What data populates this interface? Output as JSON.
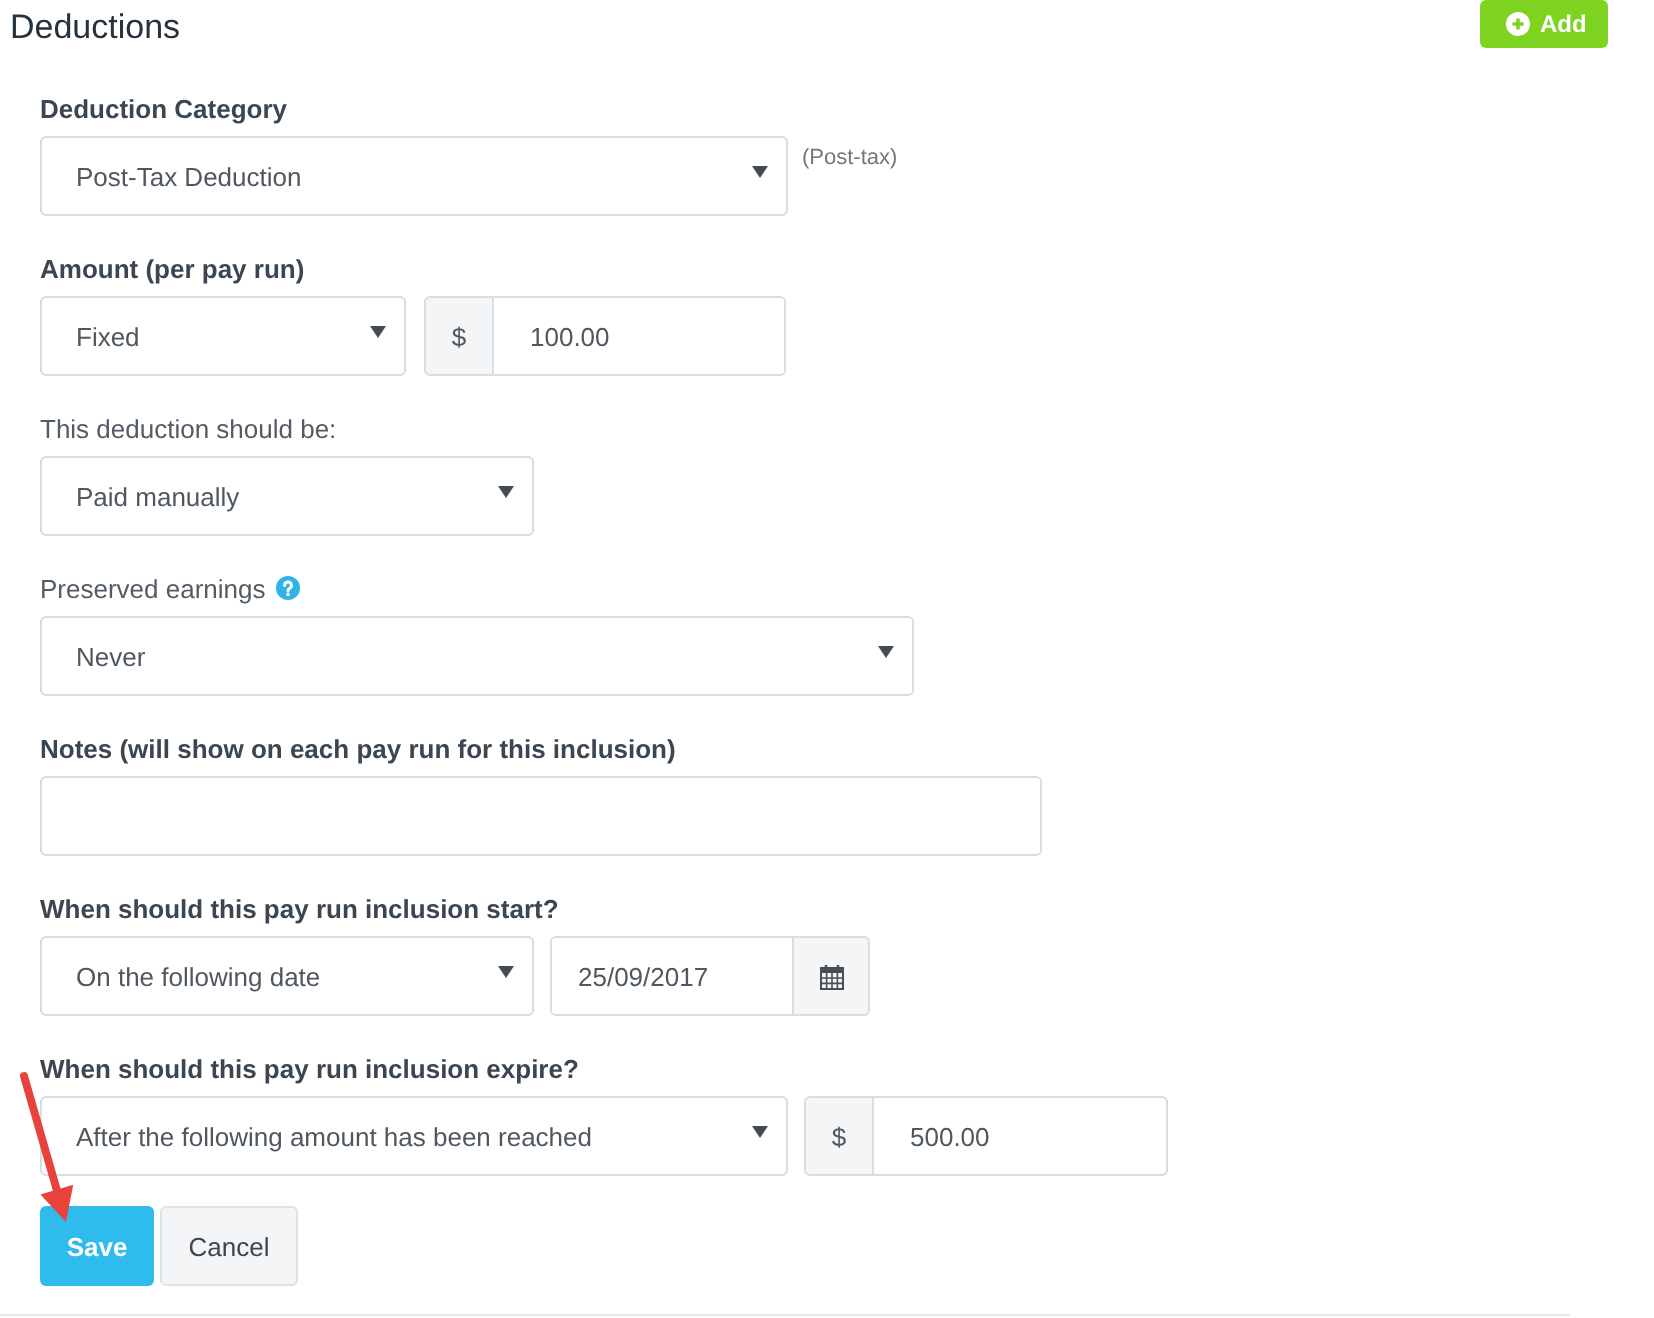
{
  "header": {
    "title": "Deductions",
    "add_button": "Add"
  },
  "fields": [
    {
      "label": "Deduction Category",
      "emphasized": true,
      "controls": [
        {
          "kind": "select",
          "value": "Post-Tax Deduction"
        }
      ],
      "note": "(Post-tax)"
    },
    {
      "label": "Amount (per pay run)",
      "emphasized": true,
      "controls": [
        {
          "kind": "select",
          "value": "Fixed"
        },
        {
          "kind": "money",
          "prefix": "$",
          "value": "100.00"
        }
      ]
    },
    {
      "label": "This deduction should be:",
      "emphasized": false,
      "controls": [
        {
          "kind": "select",
          "value": "Paid manually"
        }
      ]
    },
    {
      "label": "Preserved earnings",
      "emphasized": false,
      "help": true,
      "controls": [
        {
          "kind": "select",
          "value": "Never"
        }
      ]
    },
    {
      "label": "Notes (will show on each pay run for this inclusion)",
      "emphasized": true,
      "controls": [
        {
          "kind": "text"
        }
      ]
    },
    {
      "label": "When should this pay run inclusion start?",
      "emphasized": true,
      "controls": [
        {
          "kind": "select",
          "value": "On the following date"
        },
        {
          "kind": "date",
          "value": "25/09/2017"
        }
      ]
    },
    {
      "label": "When should this pay run inclusion expire?",
      "emphasized": true,
      "controls": [
        {
          "kind": "select",
          "value": "After the following amount has been reached"
        },
        {
          "kind": "money",
          "prefix": "$",
          "value": "500.00"
        }
      ]
    }
  ],
  "actions": [
    {
      "label": "Save",
      "kind": "primary"
    },
    {
      "label": "Cancel",
      "kind": "secondary"
    }
  ]
}
